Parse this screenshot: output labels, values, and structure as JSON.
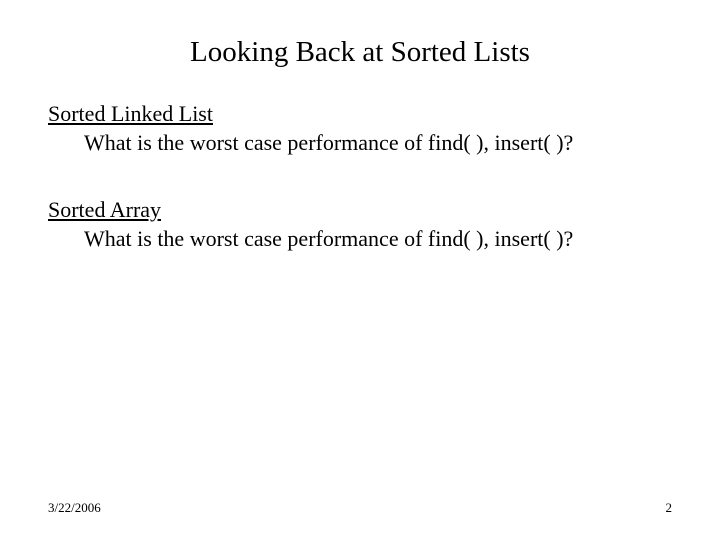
{
  "title": "Looking Back at Sorted Lists",
  "sections": [
    {
      "heading": "Sorted Linked List",
      "body": "What is the worst case performance of find( ), insert( )?"
    },
    {
      "heading": "Sorted Array",
      "body": "What is the worst case performance of find( ), insert( )?"
    }
  ],
  "footer": {
    "date": "3/22/2006",
    "page": "2"
  }
}
